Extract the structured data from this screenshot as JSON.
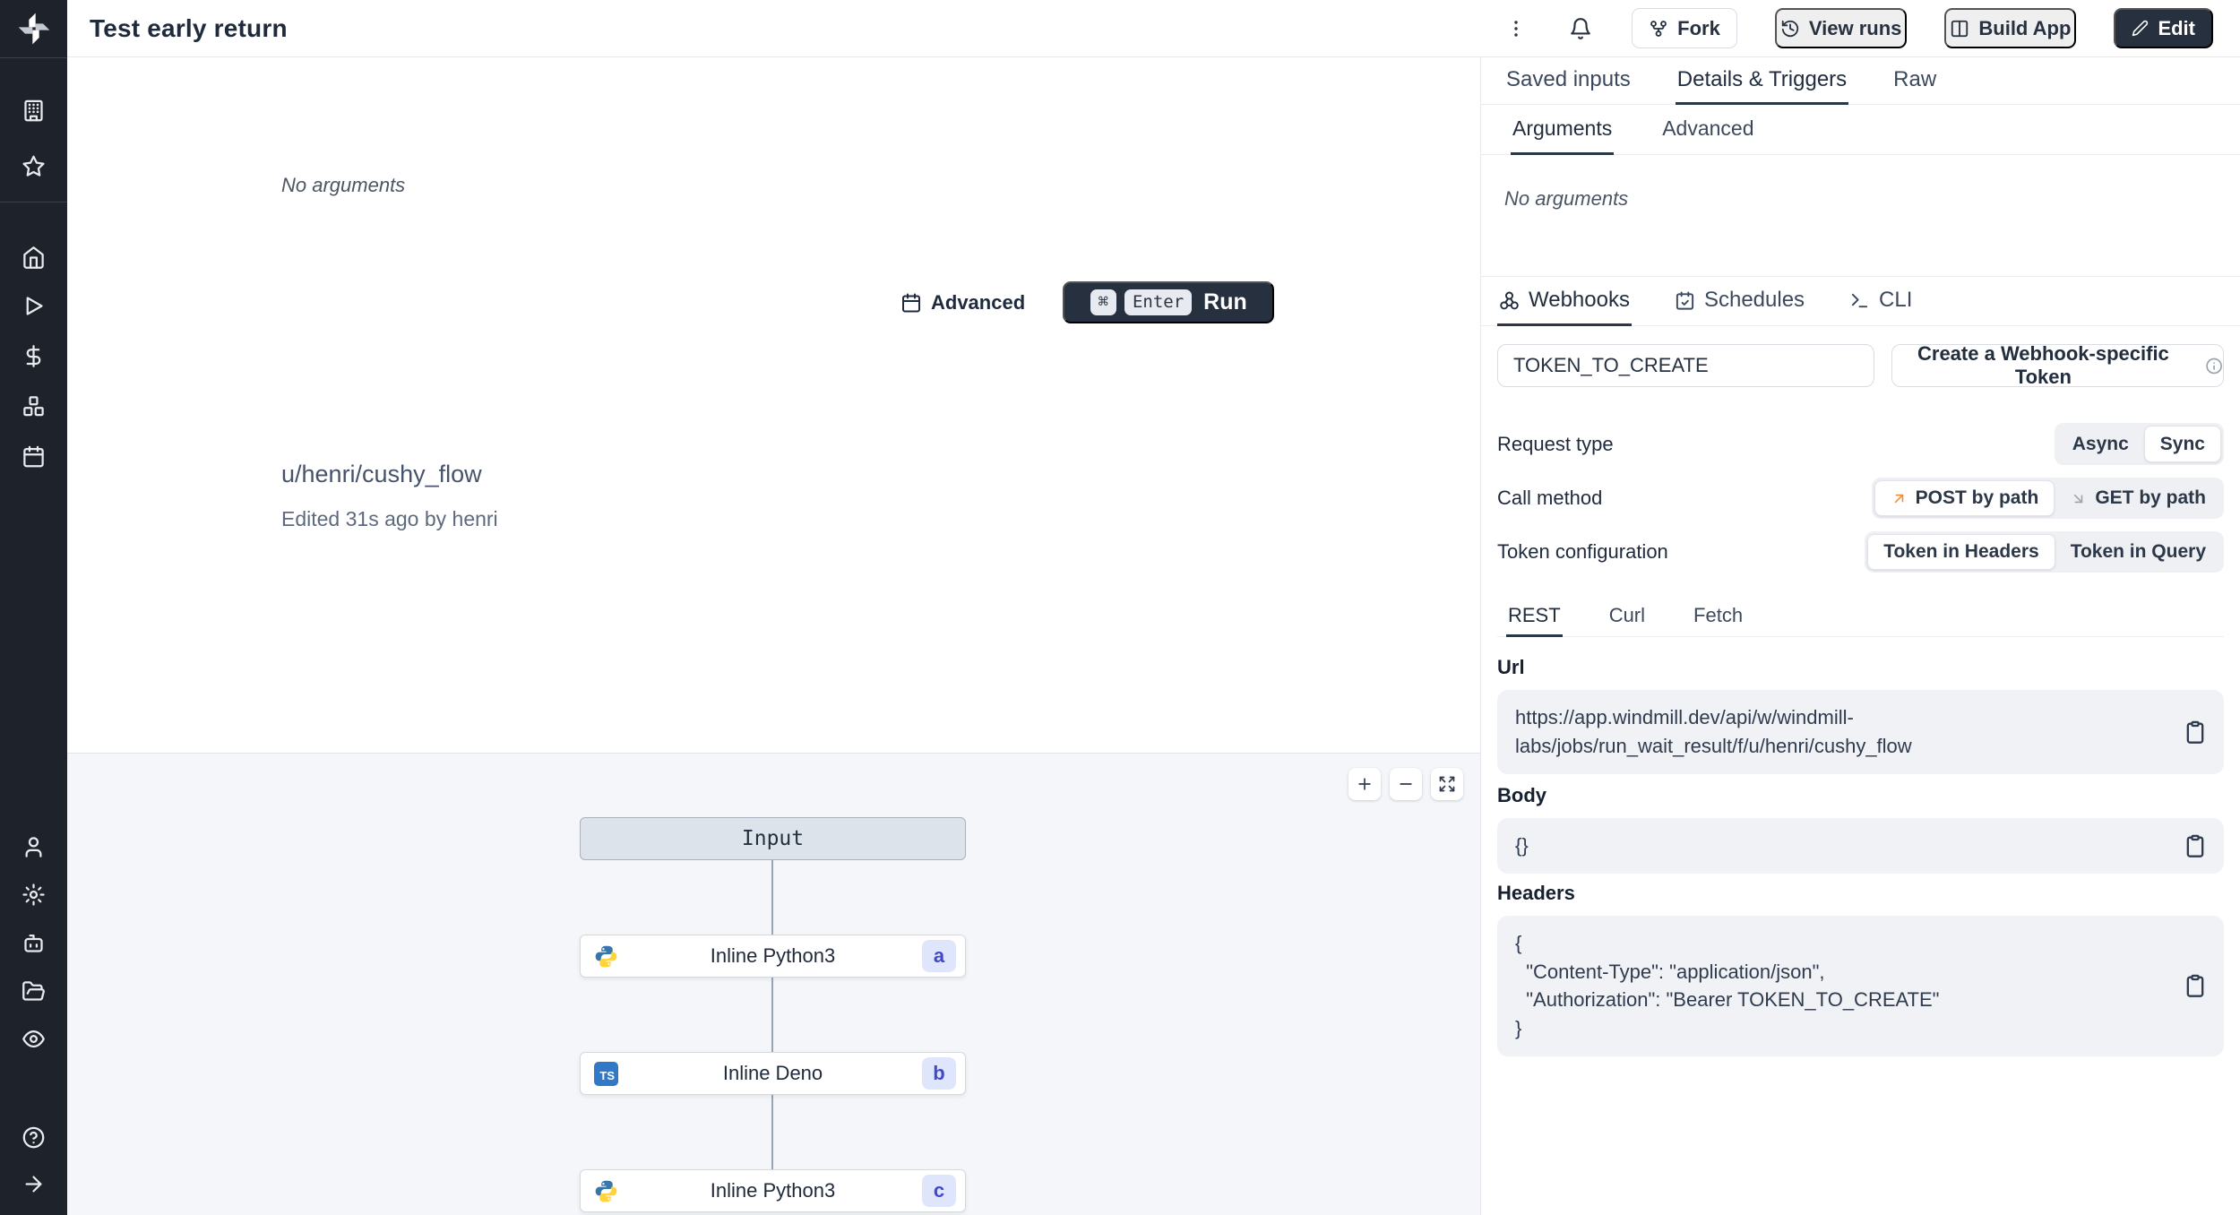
{
  "topbar": {
    "title": "Test early return",
    "fork": "Fork",
    "view_runs": "View runs",
    "build_app": "Build App",
    "edit": "Edit"
  },
  "run_panel": {
    "no_arguments": "No arguments",
    "advanced": "Advanced",
    "cmd_key": "⌘",
    "enter_key": "Enter",
    "run": "Run",
    "flow_path": "u/henri/cushy_flow",
    "edited": "Edited 31s ago by henri"
  },
  "flow": {
    "input_label": "Input",
    "ts_icon_text": "TS",
    "nodes": [
      {
        "label": "Inline Python3",
        "badge": "a",
        "lang": "python"
      },
      {
        "label": "Inline Deno",
        "badge": "b",
        "lang": "deno"
      },
      {
        "label": "Inline Python3",
        "badge": "c",
        "lang": "python"
      }
    ]
  },
  "details_panel": {
    "tabs": {
      "saved_inputs": "Saved inputs",
      "details_triggers": "Details & Triggers",
      "raw": "Raw"
    },
    "subtabs": {
      "arguments": "Arguments",
      "advanced": "Advanced"
    },
    "no_arguments": "No arguments",
    "trigger_tabs": {
      "webhooks": "Webhooks",
      "schedules": "Schedules",
      "cli": "CLI"
    },
    "token_input": "TOKEN_TO_CREATE",
    "create_token": "Create a Webhook-specific Token",
    "request_type": {
      "label": "Request type",
      "async": "Async",
      "sync": "Sync",
      "selected": "Sync"
    },
    "call_method": {
      "label": "Call method",
      "post": "POST by path",
      "get": "GET by path",
      "selected": "POST by path"
    },
    "token_config": {
      "label": "Token configuration",
      "headers": "Token in Headers",
      "query": "Token in Query",
      "selected": "Token in Headers"
    },
    "code_tabs": {
      "rest": "REST",
      "curl": "Curl",
      "fetch": "Fetch",
      "selected": "REST"
    },
    "url_label": "Url",
    "url": "https://app.windmill.dev/api/w/windmill-labs/jobs/run_wait_result/f/u/henri/cushy_flow",
    "body_label": "Body",
    "body": "{}",
    "headers_label": "Headers",
    "headers": "{\n  \"Content-Type\": \"application/json\",\n  \"Authorization\": \"Bearer TOKEN_TO_CREATE\"\n}"
  },
  "colors": {
    "sidebar_bg": "#1d222b",
    "dark_button": "#27303e",
    "badge_bg": "#dfe5fb",
    "badge_text": "#4049c8",
    "post_arrow_orange": "#f08c36",
    "get_arrow_gray": "#9aa4b2",
    "canvas_bg": "#f4f6f9",
    "input_node_bg": "#dde3ea"
  }
}
